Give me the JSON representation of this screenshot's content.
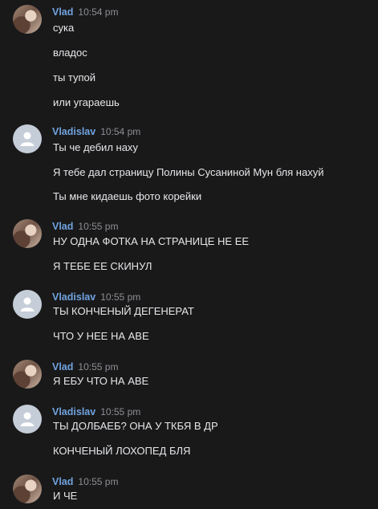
{
  "messages": [
    {
      "author": "Vlad",
      "time": "10:54 pm",
      "avatar": "photo",
      "lines": [
        "сука",
        "владос",
        "ты тупой",
        "или угараешь"
      ]
    },
    {
      "author": "Vladislav",
      "time": "10:54 pm",
      "avatar": "default",
      "lines": [
        "Ты че дебил наху",
        "Я тебе дал страницу Полины Сусаниной Мун бля нахуй",
        "Ты мне кидаешь фото корейки"
      ]
    },
    {
      "author": "Vlad",
      "time": "10:55 pm",
      "avatar": "photo",
      "lines": [
        "НУ ОДНА ФОТКА НА СТРАНИЦЕ НЕ ЕЕ",
        "Я ТЕБЕ ЕЕ СКИНУЛ"
      ]
    },
    {
      "author": "Vladislav",
      "time": "10:55 pm",
      "avatar": "default",
      "lines": [
        "ТЫ КОНЧЕНЫЙ ДЕГЕНЕРАТ",
        "ЧТО У НЕЕ НА АВЕ"
      ]
    },
    {
      "author": "Vlad",
      "time": "10:55 pm",
      "avatar": "photo",
      "lines": [
        "Я ЕБУ ЧТО НА АВЕ"
      ]
    },
    {
      "author": "Vladislav",
      "time": "10:55 pm",
      "avatar": "default",
      "lines": [
        "ТЫ ДОЛБАЕБ? ОНА У ТКБЯ В ДР",
        "КОНЧЕНЫЙ ЛОХОПЕД БЛЯ"
      ]
    },
    {
      "author": "Vlad",
      "time": "10:55 pm",
      "avatar": "photo",
      "lines": [
        "И ЧЕ"
      ]
    }
  ]
}
